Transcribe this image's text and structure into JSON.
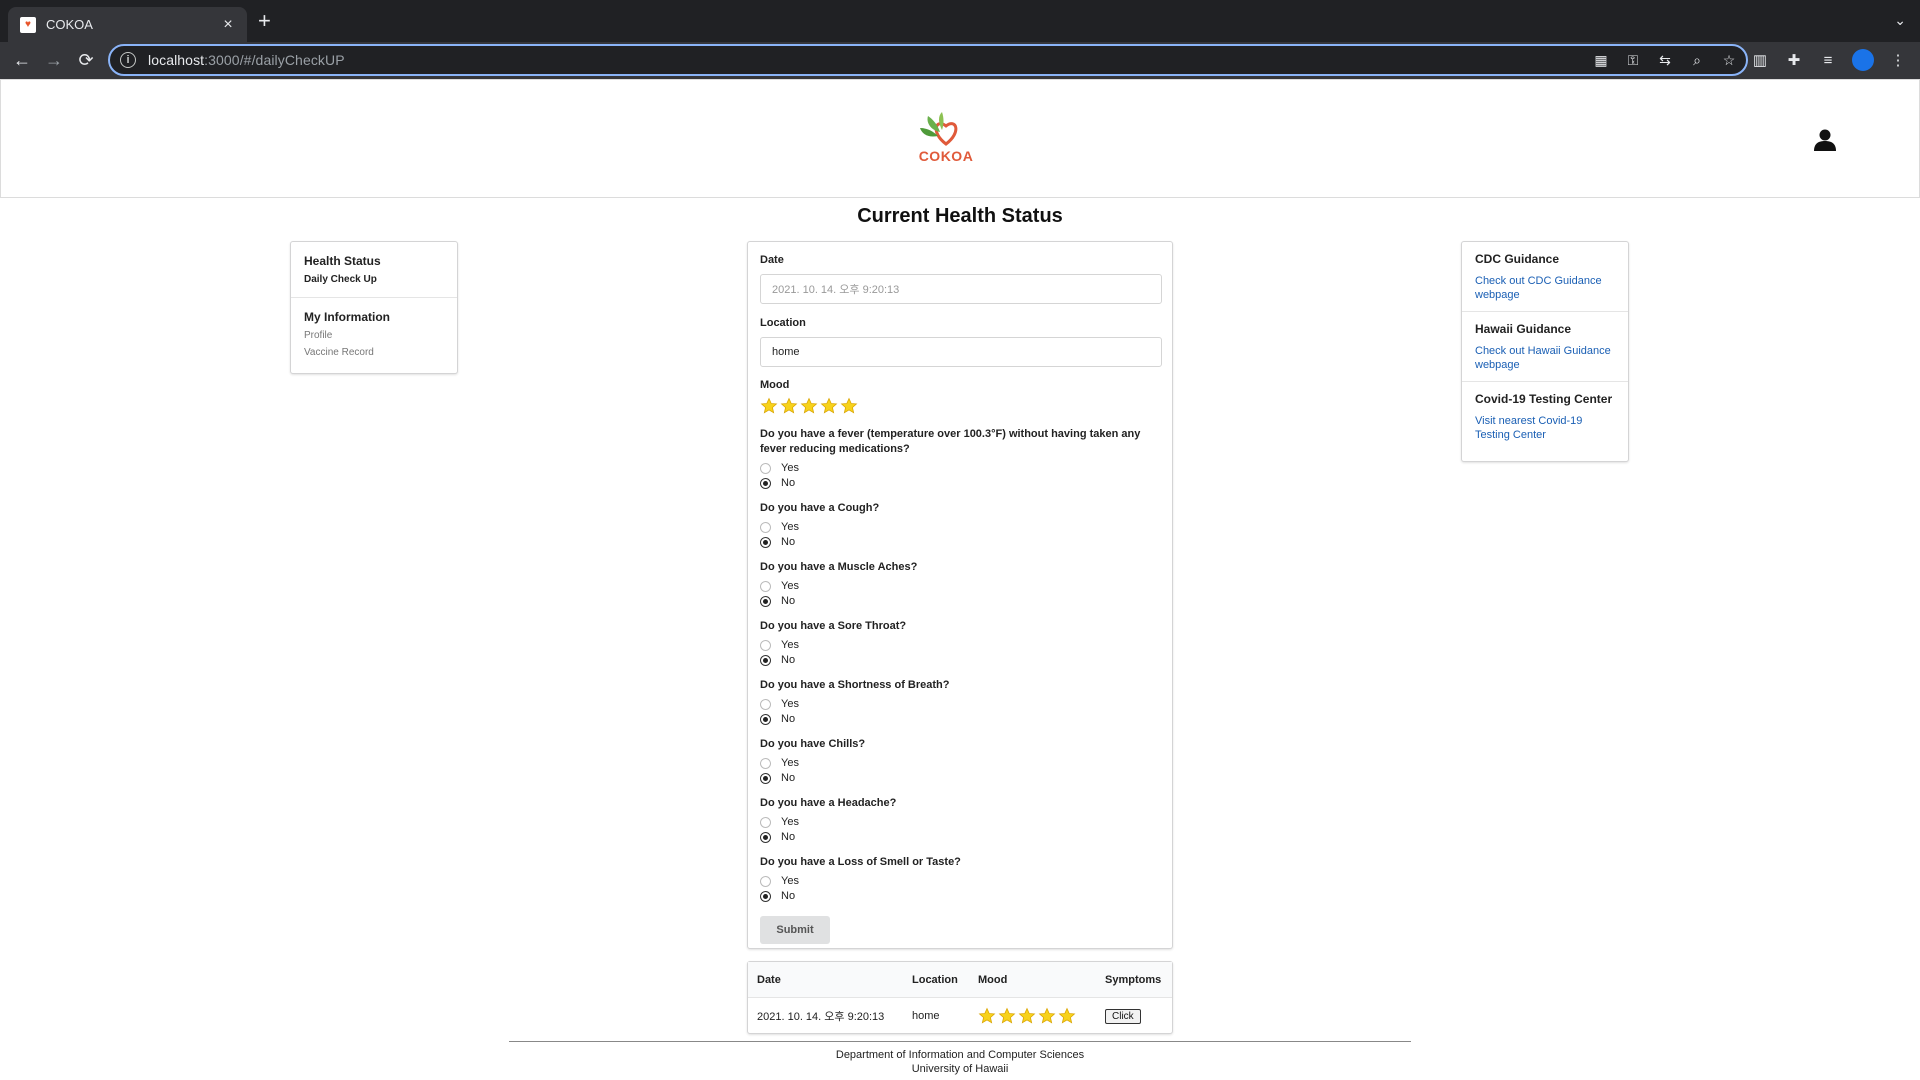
{
  "browser": {
    "tab_title": "COKOA",
    "url_host": "localhost",
    "url_rest": ":3000/#/dailyCheckUP"
  },
  "header": {
    "logo_text": "COKOA"
  },
  "page_title": "Current Health Status",
  "left_menu": {
    "groups": [
      {
        "title": "Health Status",
        "items": [
          "Daily Check Up"
        ]
      },
      {
        "title": "My Information",
        "items": [
          "Profile",
          "Vaccine Record"
        ]
      }
    ]
  },
  "right_menu": {
    "groups": [
      {
        "title": "CDC Guidance",
        "link": "Check out CDC Guidance webpage"
      },
      {
        "title": "Hawaii Guidance",
        "link": "Check out Hawaii Guidance webpage"
      },
      {
        "title": "Covid-19 Testing Center",
        "link": "Visit nearest Covid-19 Testing Center"
      }
    ]
  },
  "form": {
    "date_label": "Date",
    "date_value": "2021. 10. 14. 오후 9:20:13",
    "location_label": "Location",
    "location_value": "home",
    "mood_label": "Mood",
    "mood_rating": 5,
    "questions": [
      {
        "text": "Do you have a fever (temperature over 100.3°F) without having taken any fever reducing medications?",
        "yes": "Yes",
        "no": "No",
        "selected": "No"
      },
      {
        "text": "Do you have a Cough?",
        "yes": "Yes",
        "no": "No",
        "selected": "No"
      },
      {
        "text": "Do you have a Muscle Aches?",
        "yes": "Yes",
        "no": "No",
        "selected": "No"
      },
      {
        "text": "Do you have a Sore Throat?",
        "yes": "Yes",
        "no": "No",
        "selected": "No"
      },
      {
        "text": "Do you have a Shortness of Breath?",
        "yes": "Yes",
        "no": "No",
        "selected": "No"
      },
      {
        "text": "Do you have Chills?",
        "yes": "Yes",
        "no": "No",
        "selected": "No"
      },
      {
        "text": "Do you have a Headache?",
        "yes": "Yes",
        "no": "No",
        "selected": "No"
      },
      {
        "text": "Do you have a Loss of Smell or Taste?",
        "yes": "Yes",
        "no": "No",
        "selected": "No"
      }
    ],
    "submit_label": "Submit"
  },
  "table": {
    "headers": [
      "Date",
      "Location",
      "Mood",
      "Symptoms"
    ],
    "rows": [
      {
        "date": "2021. 10. 14. 오후 9:20:13",
        "location": "home",
        "mood": 5,
        "symptoms_button": "Click"
      }
    ]
  },
  "footer": {
    "line1": "Department of Information and Computer Sciences",
    "line2": "University of Hawaii"
  },
  "colors": {
    "star": "#f7d21a",
    "link": "#1a5fb4",
    "logo": "#e05a3a",
    "focus_ring": "#8ab4f8"
  }
}
